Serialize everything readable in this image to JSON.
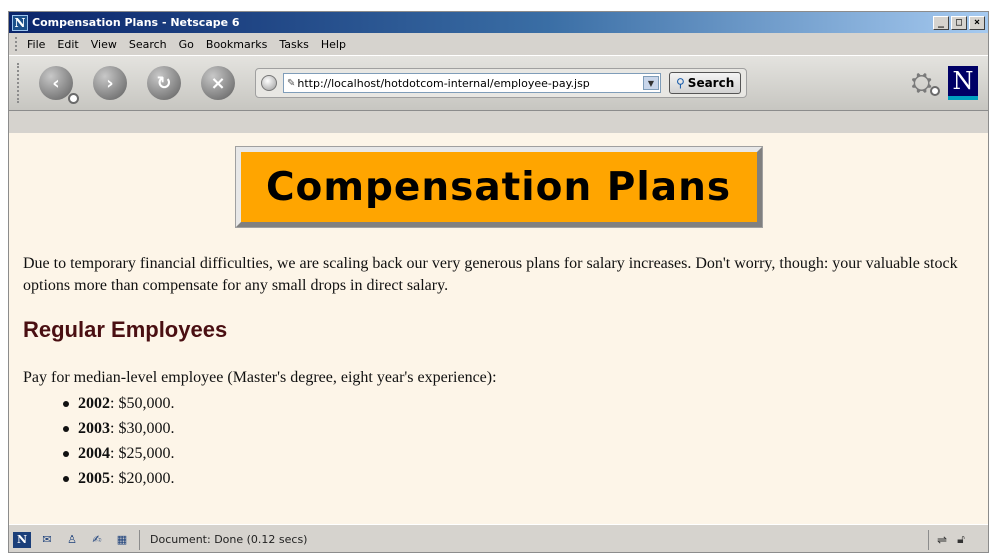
{
  "window": {
    "title": "Compensation Plans - Netscape 6",
    "controls": {
      "minimize": "_",
      "maximize": "□",
      "close": "×"
    }
  },
  "menu": {
    "items": [
      "File",
      "Edit",
      "View",
      "Search",
      "Go",
      "Bookmarks",
      "Tasks",
      "Help"
    ]
  },
  "toolbar": {
    "back_icon": "back-arrow-icon",
    "forward_icon": "forward-arrow-icon",
    "reload_icon": "reload-icon",
    "stop_icon": "stop-icon",
    "url": "http://localhost/hotdotcom-internal/employee-pay.jsp",
    "search_label": "Search"
  },
  "page": {
    "banner": "Compensation Plans",
    "paragraph": "Due to temporary financial difficulties, we are scaling back our very generous plans for salary increases. Don't worry, though: your valuable stock options more than compensate for any small drops in direct salary.",
    "heading": "Regular Employees",
    "intro": "Pay for median-level employee (Master's degree, eight year's experience):",
    "pay_list": [
      {
        "year": "2002",
        "amount": ": $50,000."
      },
      {
        "year": "2003",
        "amount": ": $30,000."
      },
      {
        "year": "2004",
        "amount": ": $25,000."
      },
      {
        "year": "2005",
        "amount": ": $20,000."
      }
    ]
  },
  "status": {
    "text": "Document: Done (0.12 secs)"
  },
  "colors": {
    "banner_bg": "#ffa500",
    "heading": "#4a0f12",
    "page_bg": "#fdf5e8"
  }
}
